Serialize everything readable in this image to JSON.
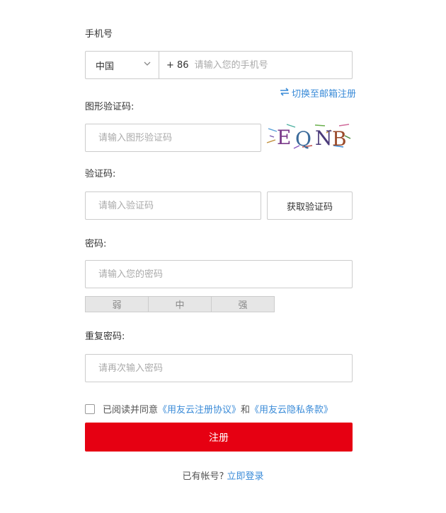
{
  "phone": {
    "label": "手机号",
    "country": "中国",
    "prefix": "+ 86",
    "placeholder": "请输入您的手机号"
  },
  "switch_email": {
    "icon": "swap-arrows-icon",
    "label": "切换至邮箱注册"
  },
  "captcha": {
    "label": "图形验证码:",
    "placeholder": "请输入图形验证码",
    "image_text": "EQNB"
  },
  "verify": {
    "label": "验证码:",
    "placeholder": "请输入验证码",
    "button": "获取验证码"
  },
  "password": {
    "label": "密码:",
    "placeholder": "请输入您的密码",
    "strength": [
      "弱",
      "中",
      "强"
    ]
  },
  "confirm": {
    "label": "重复密码:",
    "placeholder": "请再次输入密码"
  },
  "agreement": {
    "text": "已阅读并同意",
    "link1": "《用友云注册协议》",
    "and": "和",
    "link2": "《用友云隐私条款》"
  },
  "submit": "注册",
  "login": {
    "text": "已有帐号?",
    "link": "立即登录"
  },
  "colors": {
    "primary": "#e60012",
    "link": "#3a8bd8",
    "border": "#cccccc"
  }
}
